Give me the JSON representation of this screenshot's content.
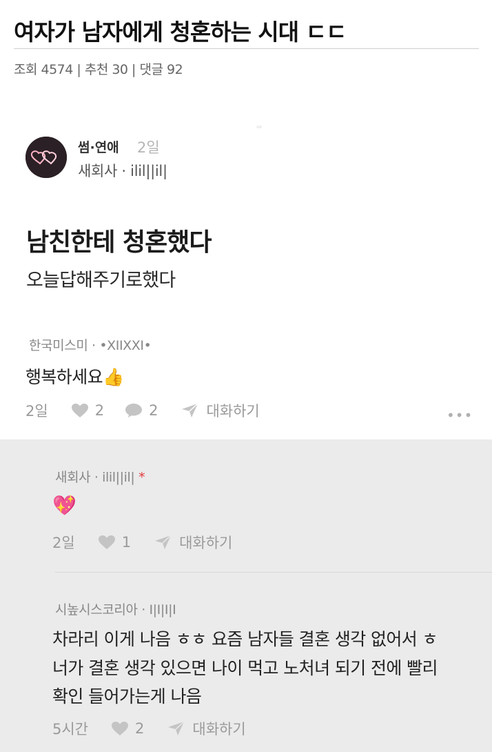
{
  "header": {
    "title": "여자가 남자에게 청혼하는 시대 ㄷㄷ",
    "meta": "조회 4574 | 추천 30 | 댓글 92"
  },
  "post": {
    "category": "썸·연애",
    "age": "2일",
    "author": "새회사 · ilil||il|",
    "title": "남친한테 청혼했다",
    "body": "오늘답해주기로했다"
  },
  "comments": [
    {
      "author": "한국미스미 · •XIIXXI•",
      "text": "행복하세요👍",
      "age": "2일",
      "likes": "2",
      "replies": "2",
      "chat_label": "대화하기",
      "more": "•••"
    }
  ],
  "replies": [
    {
      "author": "새회사 · ilil||il|",
      "star": "*",
      "text": "💖",
      "age": "2일",
      "likes": "1",
      "chat_label": "대화하기"
    },
    {
      "author": "시높시스코리아 · I|I|I|I",
      "lines": [
        "차라리 이게 나음 ㅎㅎ 요즘 남자들 결혼 생각 없어서 ㅎ",
        "너가 결혼 생각 있으면 나이 먹고 노처녀 되기 전에 빨리",
        "확인 들어가는게 나음"
      ],
      "age": "5시간",
      "likes": "2",
      "chat_label": "대화하기"
    }
  ],
  "colors": {
    "reply_bg": "#ebebeb",
    "muted": "#9a9a9a",
    "star": "#e23b3b"
  }
}
